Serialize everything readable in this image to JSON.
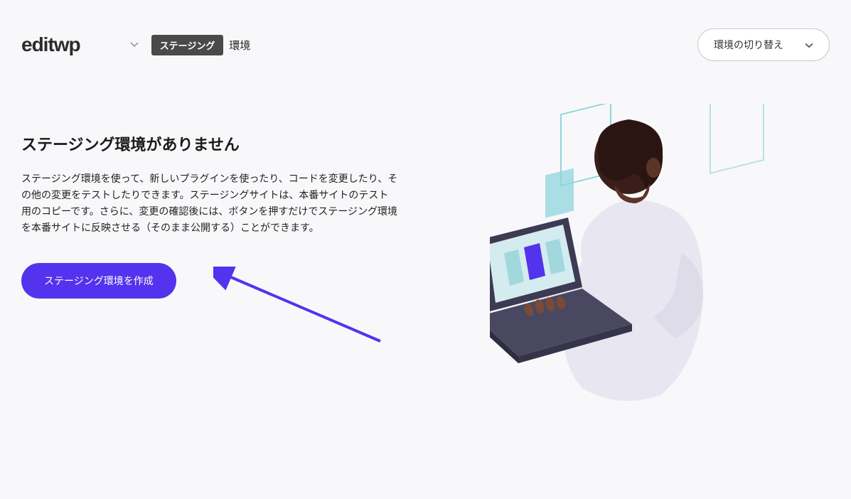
{
  "header": {
    "site_name": "editwp",
    "badge": "ステージング",
    "env_suffix": "環境",
    "env_switch_label": "環境の切り替え"
  },
  "main": {
    "title": "ステージング環境がありません",
    "description": "ステージング環境を使って、新しいプラグインを使ったり、コードを変更したり、その他の変更をテストしたりできます。ステージングサイトは、本番サイトのテスト用のコピーです。さらに、変更の確認後には、ボタンを押すだけでステージング環境を本番サイトに反映させる（そのまま公開する）ことができます。",
    "create_button": "ステージング環境を作成"
  }
}
